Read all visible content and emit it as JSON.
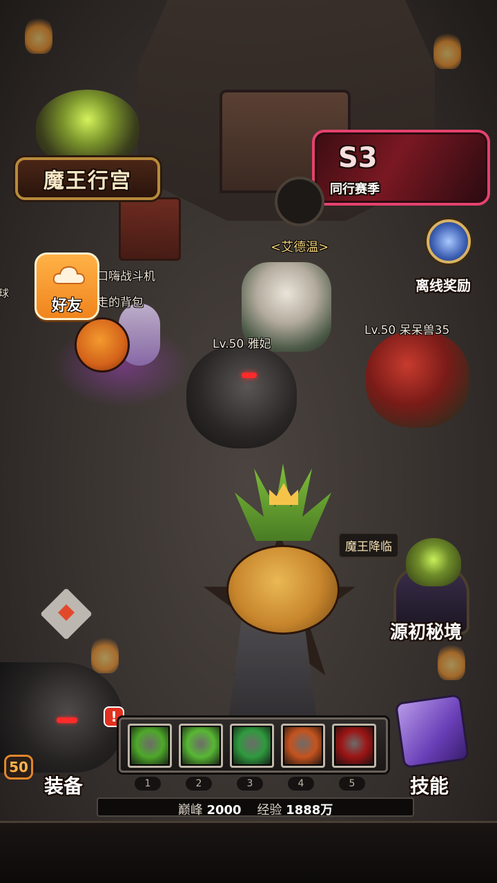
{
  "hud": {
    "palace_title": "魔王行宫",
    "season": {
      "code": "S3",
      "label": "同行赛季"
    },
    "npc_name": "<艾德温>",
    "offline_reward_label": "离线奖励",
    "friend_label": "好友",
    "demon_arrives_tag": "魔王降临",
    "origin_realm_label": "源初秘境",
    "left_wall_text": "球"
  },
  "players": [
    {
      "name": "口嗨战斗机"
    },
    {
      "name": "走的背包"
    },
    {
      "name": "Lv.50 雅妃"
    },
    {
      "name": "Lv.50 呆呆兽35"
    }
  ],
  "bottom": {
    "hero_level": "50",
    "equip_label": "装备",
    "alert": "!",
    "skills_label": "技能",
    "skill_slots": [
      {
        "num": "1",
        "color": "#4ea82a",
        "icon": "arrow-skill-icon"
      },
      {
        "num": "2",
        "color": "#58b734",
        "icon": "triple-arrow-skill-icon"
      },
      {
        "num": "3",
        "color": "#2f9a3e",
        "icon": "whirlwind-skill-icon"
      },
      {
        "num": "4",
        "color": "#c5531e",
        "icon": "fire-orb-skill-icon"
      },
      {
        "num": "5",
        "color": "#9c1414",
        "icon": "demon-face-skill-icon"
      }
    ],
    "rank_label": "巅峰",
    "rank_value": "2000",
    "exp_label": "经验",
    "exp_value": "1888万"
  }
}
